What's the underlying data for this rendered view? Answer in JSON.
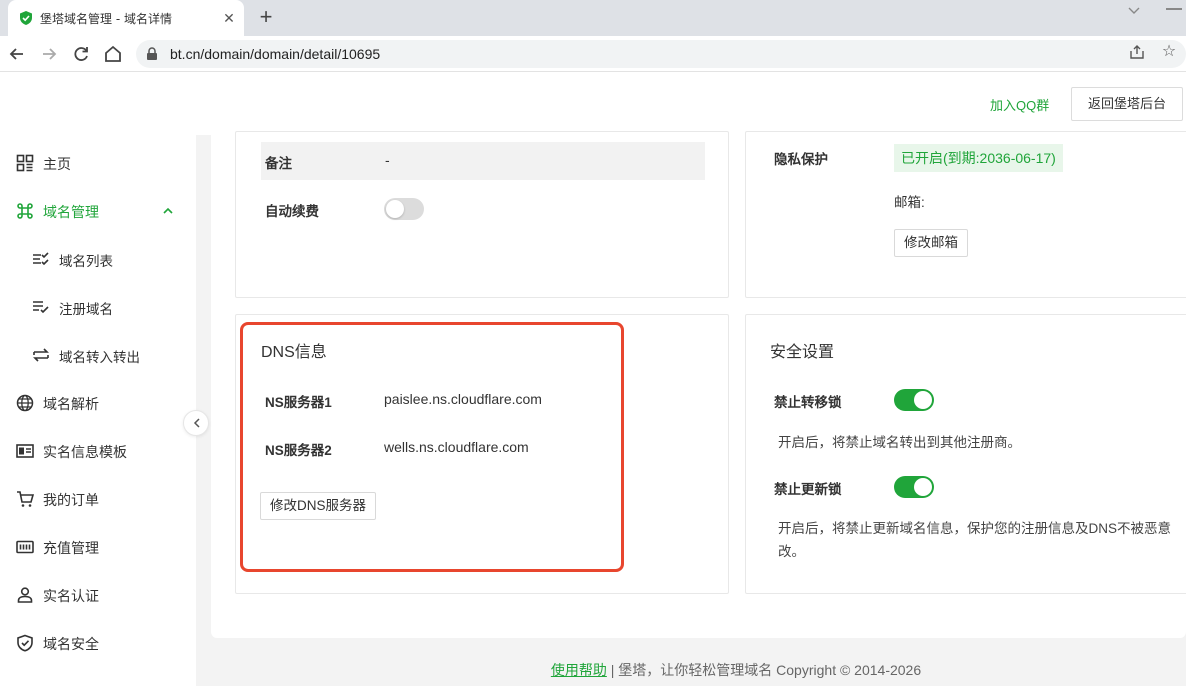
{
  "browser": {
    "tab_title": "堡塔域名管理 - 域名详情",
    "tab_close": "✕",
    "new_tab": "+",
    "url": "bt.cn/domain/domain/detail/10695",
    "star": "☆"
  },
  "header": {
    "qq_link": "加入QQ群",
    "back_button": "返回堡塔后台"
  },
  "sidebar": {
    "items": [
      {
        "label": "主页",
        "icon": "dashboard-icon"
      },
      {
        "label": "域名管理",
        "icon": "command-icon",
        "active": true
      },
      {
        "label": "域名列表",
        "icon": "list-check-icon"
      },
      {
        "label": "注册域名",
        "icon": "list-add-icon"
      },
      {
        "label": "域名转入转出",
        "icon": "transfer-icon"
      },
      {
        "label": "域名解析",
        "icon": "globe-icon"
      },
      {
        "label": "实名信息模板",
        "icon": "id-card-icon"
      },
      {
        "label": "我的订单",
        "icon": "cart-icon"
      },
      {
        "label": "充值管理",
        "icon": "wallet-icon"
      },
      {
        "label": "实名认证",
        "icon": "user-icon"
      },
      {
        "label": "域名安全",
        "icon": "shield-icon"
      }
    ]
  },
  "basic_info": {
    "note_label": "备注",
    "note_value": "-",
    "auto_renew_label": "自动续费",
    "auto_renew_on": false
  },
  "privacy": {
    "label": "隐私保护",
    "status": "已开启(到期:2036-06-17)",
    "email_label": "邮箱:",
    "edit_email_button": "修改邮箱"
  },
  "dns": {
    "title": "DNS信息",
    "ns1_label": "NS服务器1",
    "ns1_value": "paislee.ns.cloudflare.com",
    "ns2_label": "NS服务器2",
    "ns2_value": "wells.ns.cloudflare.com",
    "edit_button": "修改DNS服务器"
  },
  "security": {
    "title": "安全设置",
    "transfer_lock_label": "禁止转移锁",
    "transfer_lock_on": true,
    "transfer_lock_desc": "开启后，将禁止域名转出到其他注册商。",
    "update_lock_label": "禁止更新锁",
    "update_lock_on": true,
    "update_lock_desc_line1": "开启后，将禁止更新域名信息，保护您的注册信息及DNS不被恶意",
    "update_lock_desc_line2": "改。"
  },
  "footer": {
    "help_link": "使用帮助",
    "text": " | 堡塔，让你轻松管理域名 Copyright © 2014-2026"
  },
  "colors": {
    "accent": "#20a53a",
    "highlight": "#e8462e"
  }
}
